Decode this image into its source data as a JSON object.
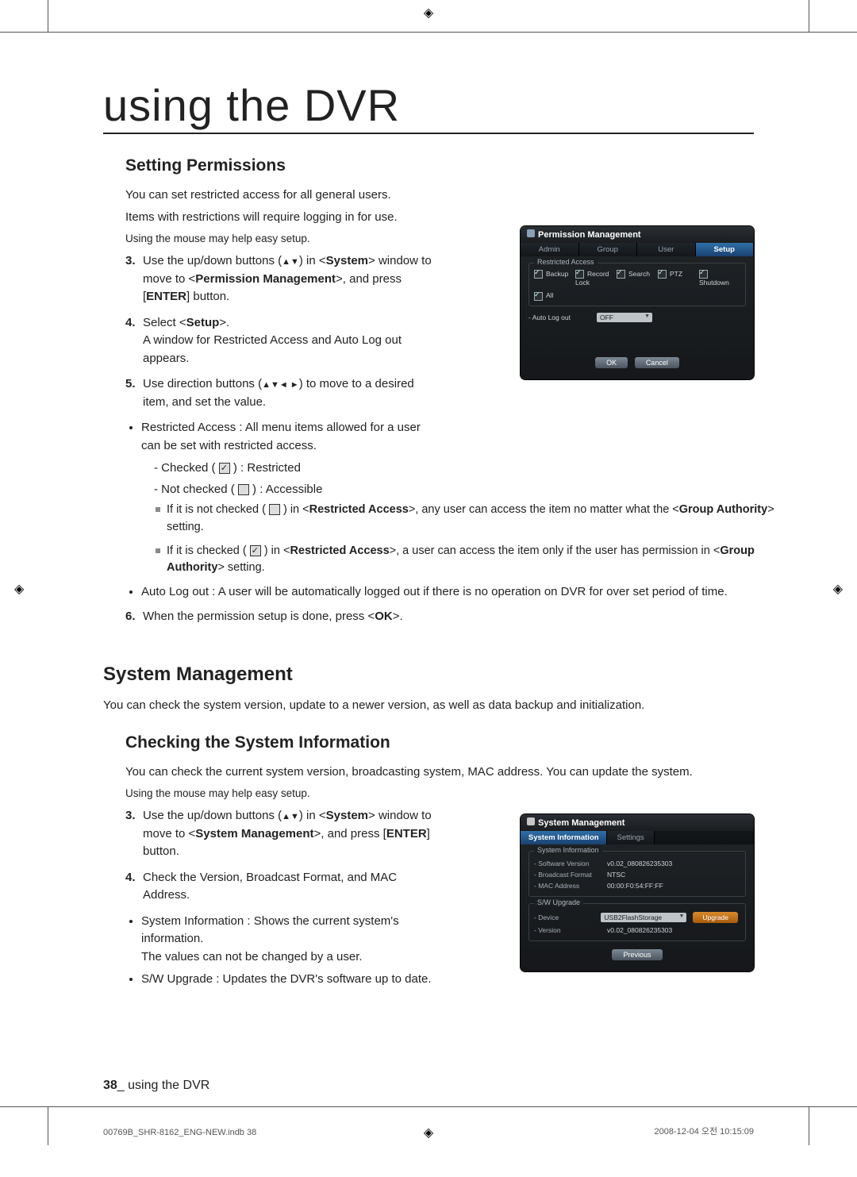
{
  "page": {
    "title": "using the DVR",
    "page_num": "38",
    "footer": "using the DVR",
    "meta_left": "00769B_SHR-8162_ENG-NEW.indb   38",
    "meta_right": "2008-12-04   오전 10:15:09"
  },
  "permissions": {
    "heading": "Setting Permissions",
    "intro1": "You can set restricted access for all general users.",
    "intro2": "Items with restrictions will require logging in for use.",
    "mouse_hint": "Using the mouse may help easy setup.",
    "step3_num": "3.",
    "step3": "Use the up/down buttons (▲▼) in <System> window to move to <Permission Management>, and press [ENTER] button.",
    "step4_num": "4.",
    "step4_a": "Select <",
    "step4_b": "Setup",
    "step4_c": ">.",
    "step4_d": "A window for Restricted Access and Auto Log out appears.",
    "step5_num": "5.",
    "step5": "Use direction buttons (▲▼◄ ►) to move to a desired item, and set the value.",
    "bullet_ra": "Restricted Access : All menu items allowed for a user can be set with restricted access.",
    "dash_checked": "Checked ( ",
    "dash_checked_end": " ) : Restricted",
    "dash_unchecked": "Not checked ( ",
    "dash_unchecked_end": " ) : Accessible",
    "note1_a": "If it is not checked ( ",
    "note1_b": " ) in <",
    "note1_c": "Restricted Access",
    "note1_d": ">, any user can access the item no matter what the <",
    "note1_e": "Group Authority",
    "note1_f": "> setting.",
    "note2_a": "If it is checked ( ",
    "note2_b": " ) in <",
    "note2_c": "Restricted Access",
    "note2_d": ">, a user can access the item only if the user has permission in <",
    "note2_e": "Group Authority",
    "note2_f": "> setting.",
    "bullet_alo": "Auto Log out : A user will be automatically logged out if there is no operation on DVR for over set period of time.",
    "step6_num": "6.",
    "step6_a": "When the permission setup is done, press <",
    "step6_b": "OK",
    "step6_c": ">."
  },
  "sysmgmt": {
    "heading": "System Management",
    "intro": "You can check the system version, update to a newer version, as well as data backup and initialization.",
    "sub": "Checking the System Information",
    "intro2": "You can check the current system version, broadcasting system, MAC address. You can update the system.",
    "mouse_hint": "Using the mouse may help easy setup.",
    "step3_num": "3.",
    "step3": "Use the up/down buttons (▲▼) in <System> window to move to <System Management>, and press [ENTER] button.",
    "step4_num": "4.",
    "step4": "Check the Version, Broadcast Format, and MAC Address.",
    "bul_si_a": "System Information : Shows the current system's information.",
    "bul_si_b": "The values can not be changed by a user.",
    "bul_sw": "S/W Upgrade : Updates the DVR's software up to date."
  },
  "panel_perm": {
    "title": "Permission Management",
    "tab_admin": "Admin",
    "tab_group": "Group",
    "tab_user": "User",
    "tab_setup": "Setup",
    "legend_ra": "Restricted Access",
    "cb_backup": "Backup",
    "cb_recordlock": "Record Lock",
    "cb_search": "Search",
    "cb_ptz": "PTZ",
    "cb_shutdown": "Shutdown",
    "cb_all": "All",
    "row_autolog": "- Auto Log out",
    "dd_off": "OFF",
    "btn_ok": "OK",
    "btn_cancel": "Cancel"
  },
  "panel_sys": {
    "title": "System Management",
    "tab_sysinfo": "System Information",
    "tab_settings": "Settings",
    "legend_si": "System Information",
    "row_sw_label": "- Software Version",
    "row_sw_val": "v0.02_080826235303",
    "row_bf_label": "- Broadcast Format",
    "row_bf_val": "NTSC",
    "row_mac_label": "- MAC Address",
    "row_mac_val": "00:00:F0:54:FF:FF",
    "legend_sw": "S/W Upgrade",
    "row_dev_label": "- Device",
    "dd_device": "USB2FlashStorage",
    "btn_upgrade": "Upgrade",
    "row_ver_label": "- Version",
    "row_ver_val": "v0.02_080826235303",
    "btn_prev": "Previous"
  }
}
